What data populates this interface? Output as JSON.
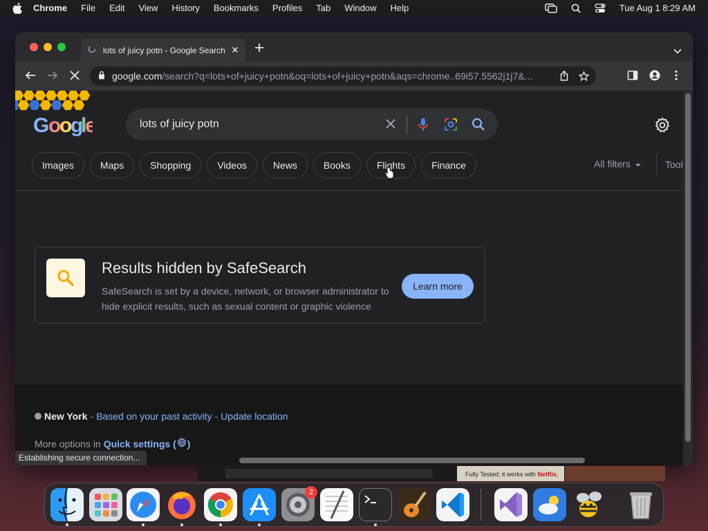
{
  "menubar": {
    "app_name": "Chrome",
    "items": [
      "File",
      "Edit",
      "View",
      "History",
      "Bookmarks",
      "Profiles",
      "Tab",
      "Window",
      "Help"
    ],
    "clock": "Tue Aug 1  8:29 AM"
  },
  "tab": {
    "title": "lots of juicy potn - Google Search"
  },
  "omnibox": {
    "host": "google.com",
    "path": "/search?q=lots+of+juicy+potn&oq=lots+of+juicy+potn&aqs=chrome..69i57.5562j1j7&..."
  },
  "search": {
    "query": "lots of juicy potn"
  },
  "chips": [
    "Images",
    "Maps",
    "Shopping",
    "Videos",
    "News",
    "Books",
    "Flights",
    "Finance"
  ],
  "filters": {
    "all_filters": "All filters",
    "tools": "Tools"
  },
  "safesearch": {
    "heading": "Results hidden by SafeSearch",
    "description": "SafeSearch is set by a device, network, or browser administrator to hide explicit results, such as sexual content or graphic violence",
    "button": "Learn more"
  },
  "footer": {
    "city": "New York",
    "sep1": "-",
    "past_activity": "Based on your past activity",
    "sep2": "-",
    "update_location": "Update location",
    "more_options": "More options in",
    "quick_settings": "Quick settings (",
    "quick_settings_close": ")"
  },
  "status": {
    "text": "Establishing secure connection..."
  },
  "background": {
    "banner_text": "Fully Tested; it works with",
    "banner_brand": "Netflix."
  },
  "dock": {
    "settings_badge": "2",
    "apps": [
      "finder-icon",
      "launchpad-icon",
      "safari-icon",
      "firefox-icon",
      "chrome-icon",
      "app-store-icon",
      "system-settings-icon",
      "textedit-icon",
      "terminal-icon",
      "garageband-icon",
      "vscode-icon",
      "visual-studio-icon",
      "weather-icon",
      "bee-app-icon",
      "trash-icon"
    ]
  },
  "colors": {
    "accent_blue": "#8ab4f8",
    "page_bg": "#202124",
    "safesearch_icon_bg": "#fef7e0"
  }
}
